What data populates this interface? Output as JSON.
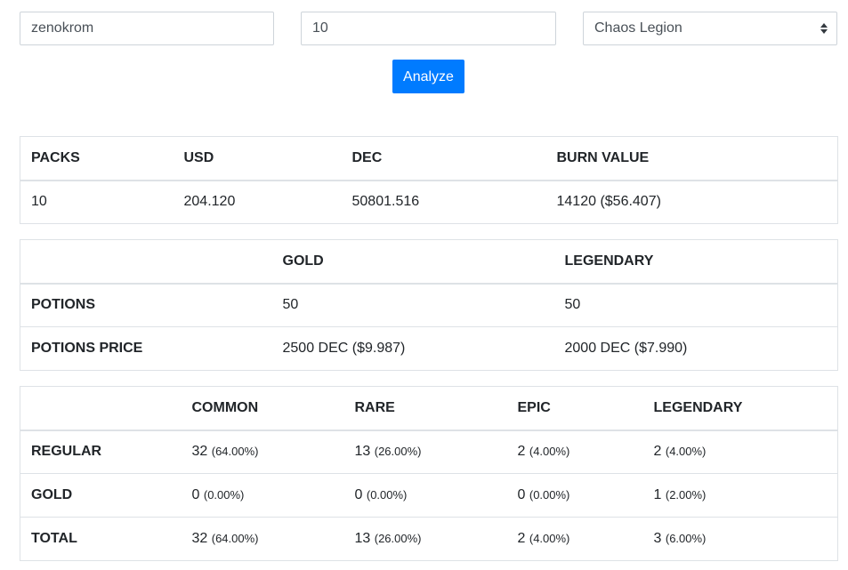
{
  "form": {
    "username_value": "zenokrom",
    "packs_value": "10",
    "edition_selected": "Chaos Legion",
    "analyze_label": "Analyze"
  },
  "summary_table": {
    "headers": [
      "PACKS",
      "USD",
      "DEC",
      "BURN VALUE"
    ],
    "row": [
      "10",
      "204.120",
      "50801.516",
      "14120 ($56.407)"
    ]
  },
  "potions_table": {
    "headers": [
      "",
      "GOLD",
      "LEGENDARY"
    ],
    "rows": [
      {
        "label": "POTIONS",
        "values": [
          "50",
          "50"
        ]
      },
      {
        "label": "POTIONS PRICE",
        "values": [
          "2500 DEC ($9.987)",
          "2000 DEC ($7.990)"
        ]
      }
    ]
  },
  "rarity_table": {
    "headers": [
      "",
      "COMMON",
      "RARE",
      "EPIC",
      "LEGENDARY"
    ],
    "rows": [
      {
        "label": "REGULAR",
        "cells": [
          {
            "count": "32",
            "pct": "(64.00%)"
          },
          {
            "count": "13",
            "pct": "(26.00%)"
          },
          {
            "count": "2",
            "pct": "(4.00%)"
          },
          {
            "count": "2",
            "pct": "(4.00%)"
          }
        ]
      },
      {
        "label": "GOLD",
        "cells": [
          {
            "count": "0",
            "pct": "(0.00%)"
          },
          {
            "count": "0",
            "pct": "(0.00%)"
          },
          {
            "count": "0",
            "pct": "(0.00%)"
          },
          {
            "count": "1",
            "pct": "(2.00%)"
          }
        ]
      },
      {
        "label": "TOTAL",
        "cells": [
          {
            "count": "32",
            "pct": "(64.00%)"
          },
          {
            "count": "13",
            "pct": "(26.00%)"
          },
          {
            "count": "2",
            "pct": "(4.00%)"
          },
          {
            "count": "3",
            "pct": "(6.00%)"
          }
        ]
      }
    ]
  },
  "colors": {
    "primary": "#007bff",
    "border": "#dee2e6"
  }
}
